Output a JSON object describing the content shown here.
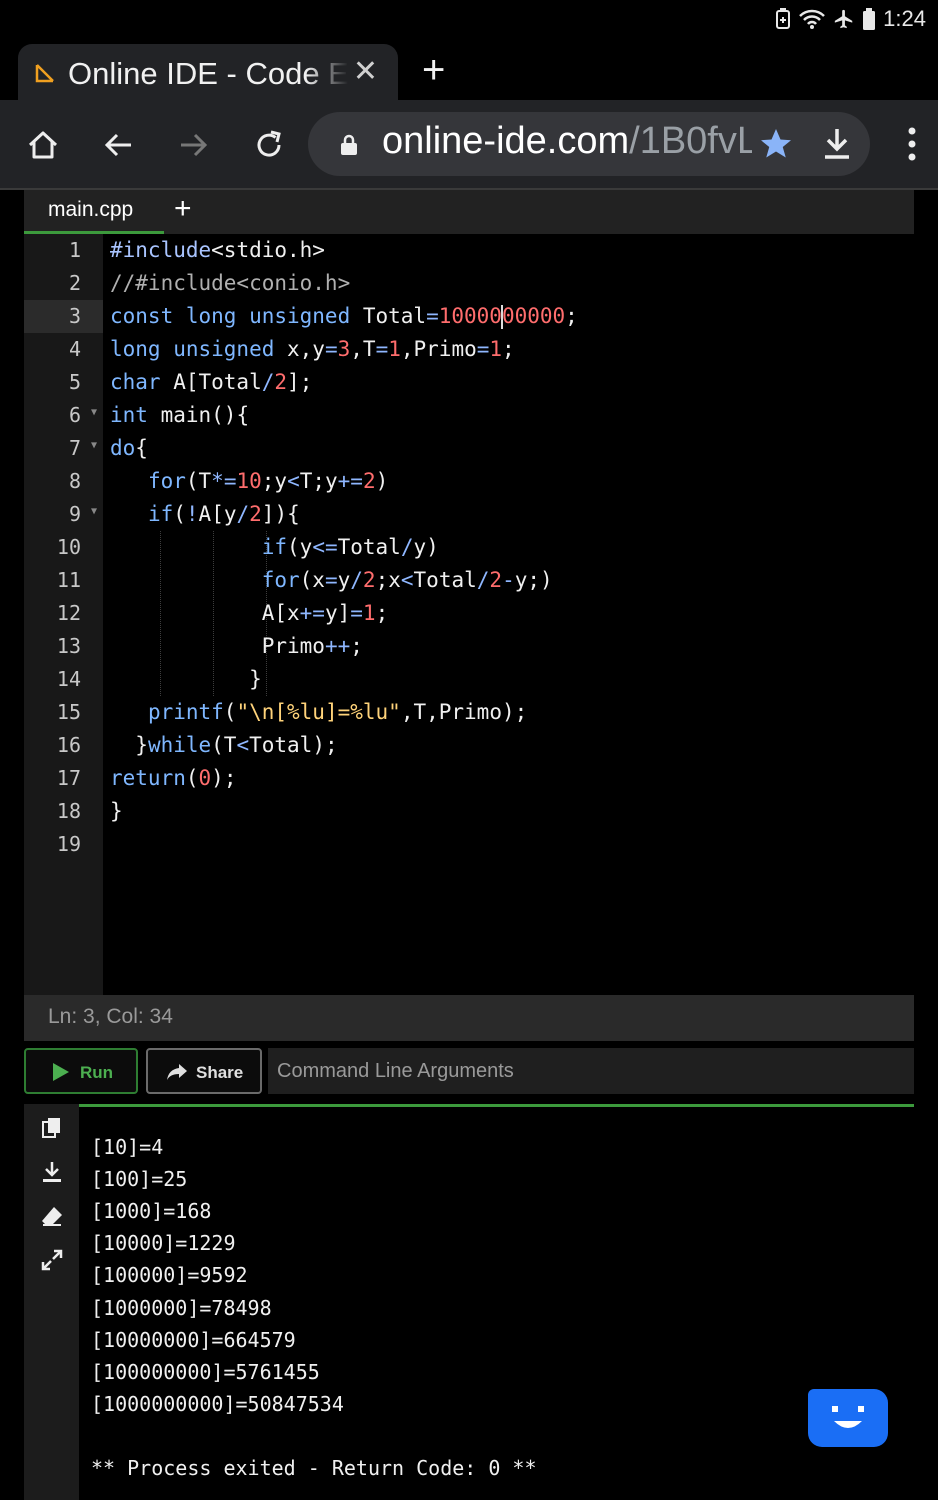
{
  "status_bar": {
    "time": "1:24"
  },
  "browser": {
    "tab_title": "Online IDE - Code Editor",
    "url_host": "online-ide.com",
    "url_path": "/1B0fvL"
  },
  "ide": {
    "file_tab": "main.cpp",
    "add_file": "+",
    "line_numbers": [
      "1",
      "2",
      "3",
      "4",
      "5",
      "6",
      "7",
      "8",
      "9",
      "10",
      "11",
      "12",
      "13",
      "14",
      "15",
      "16",
      "17",
      "18",
      "19"
    ],
    "status": "Ln: 3,  Col: 34",
    "run_label": "Run",
    "share_label": "Share",
    "args_placeholder": "Command Line Arguments"
  },
  "console": {
    "lines": [
      "[10]=4",
      "[100]=25",
      "[1000]=168",
      "[10000]=1229",
      "[100000]=9592",
      "[1000000]=78498",
      "[10000000]=664579",
      "[100000000]=5761455",
      "[1000000000]=50847534",
      "",
      "** Process exited - Return Code: 0 **"
    ]
  },
  "colors": {
    "accent_green": "#4caf50",
    "chat_blue": "#1a6ef5",
    "star_blue": "#8ab4f8"
  }
}
